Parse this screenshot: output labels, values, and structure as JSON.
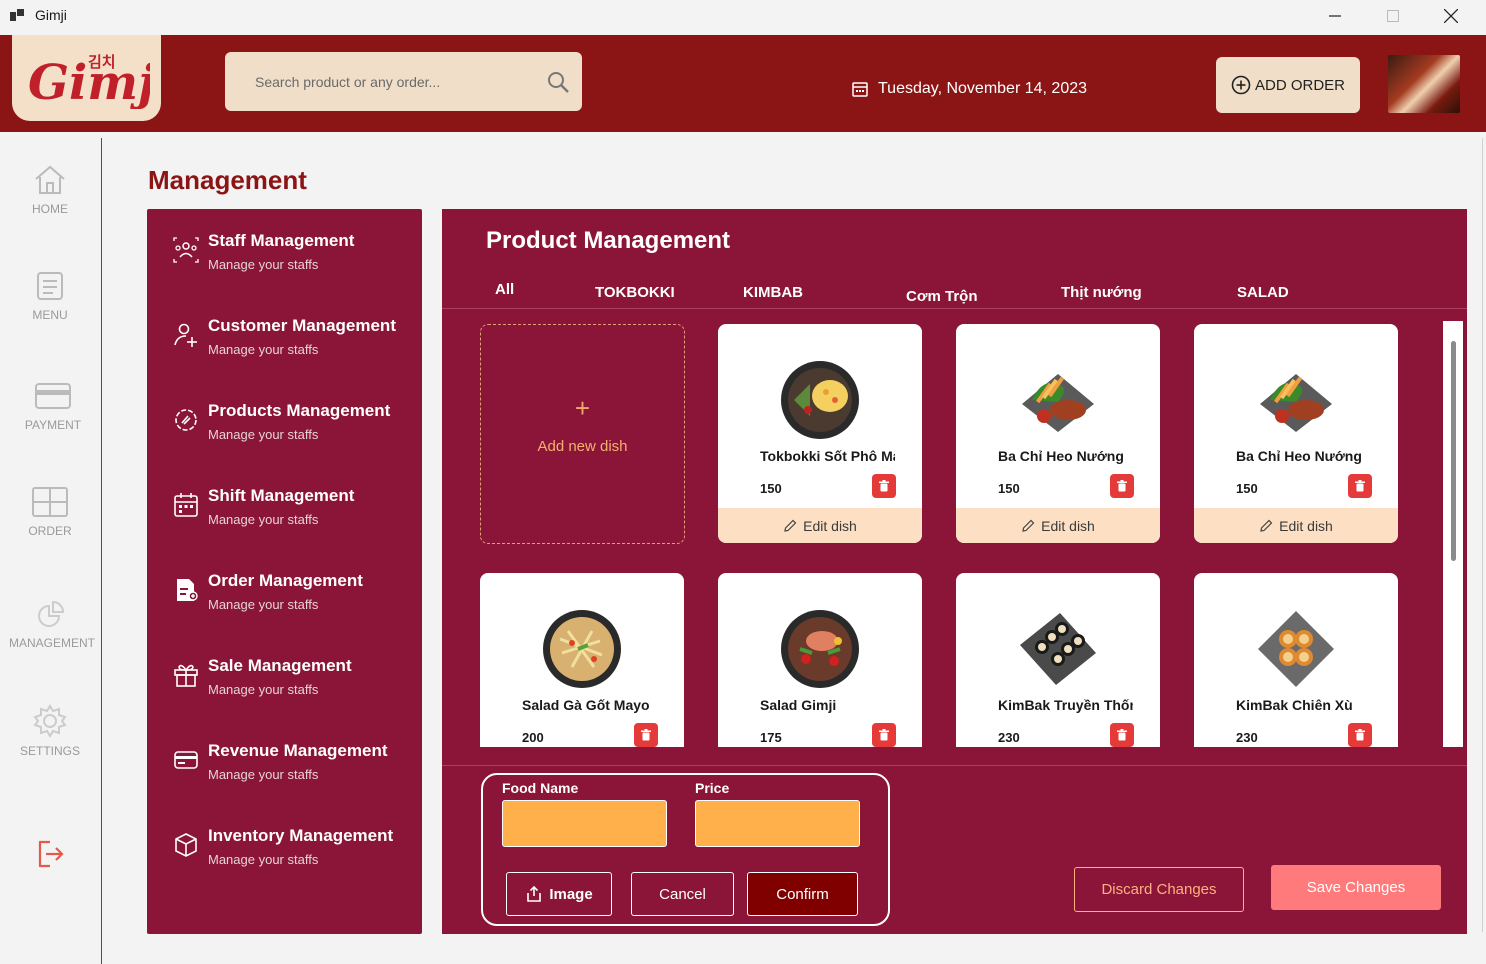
{
  "window": {
    "title": "Gimji"
  },
  "header": {
    "logo_text": "Gimji",
    "logo_korean": "김치",
    "search_placeholder": "Search product or any order...",
    "date": "Tuesday, November 14, 2023",
    "add_order_label": "ADD ORDER"
  },
  "nav": {
    "items": [
      {
        "label": "HOME",
        "icon": "home-icon"
      },
      {
        "label": "MENU",
        "icon": "menu-icon"
      },
      {
        "label": "PAYMENT",
        "icon": "payment-icon"
      },
      {
        "label": "ORDER",
        "icon": "order-icon"
      },
      {
        "label": "MANAGEMENT",
        "icon": "management-icon"
      },
      {
        "label": "SETTINGS",
        "icon": "gear-icon"
      }
    ],
    "logout_icon": "logout-icon"
  },
  "page": {
    "title": "Management"
  },
  "management": {
    "items": [
      {
        "title": "Staff Management",
        "subtitle": "Manage your staffs",
        "icon": "staff-icon"
      },
      {
        "title": "Customer Management",
        "subtitle": "Manage your staffs",
        "icon": "customer-icon"
      },
      {
        "title": "Products Management",
        "subtitle": "Manage your staffs",
        "icon": "products-icon"
      },
      {
        "title": "Shift Management",
        "subtitle": "Manage your staffs",
        "icon": "calendar-icon"
      },
      {
        "title": "Order Management",
        "subtitle": "Manage your staffs",
        "icon": "order-doc-icon"
      },
      {
        "title": "Sale Management",
        "subtitle": "Manage your staffs",
        "icon": "gift-icon"
      },
      {
        "title": "Revenue Management",
        "subtitle": "Manage your staffs",
        "icon": "card-icon"
      },
      {
        "title": "Inventory Management",
        "subtitle": "Manage your staffs",
        "icon": "box-icon"
      }
    ]
  },
  "products": {
    "title": "Product Management",
    "tabs": [
      "All",
      "TOKBOKKI",
      "KIMBAB",
      "Cơm Trộn",
      "Thịt nướng",
      "SALAD"
    ],
    "add_new_label": "Add new dish",
    "add_plus": "+",
    "edit_label": "Edit dish",
    "dishes": [
      {
        "name": "Tokbokki Sốt Phô Mai",
        "price": "150",
        "image": "tokbokki-image"
      },
      {
        "name": "Ba Chỉ Heo Nướng",
        "price": "150",
        "image": "grilled-pork-image"
      },
      {
        "name": "Ba Chỉ Heo Nướng",
        "price": "150",
        "image": "grilled-pork-image"
      },
      {
        "name": "Salad Gà Gốt Mayo",
        "price": "200",
        "image": "salad-image"
      },
      {
        "name": "Salad Gimji",
        "price": "175",
        "image": "salad-gimji-image"
      },
      {
        "name": "KimBak Truyền Thống",
        "price": "230",
        "image": "kimbap-image"
      },
      {
        "name": "KimBak Chiên Xù",
        "price": "230",
        "image": "fried-kimbap-image"
      }
    ]
  },
  "form": {
    "food_name_label": "Food Name",
    "price_label": "Price",
    "food_name_value": "",
    "price_value": "",
    "image_label": "Image",
    "cancel_label": "Cancel",
    "confirm_label": "Confirm"
  },
  "actions": {
    "discard_label": "Discard Changes",
    "save_label": "Save Changes"
  },
  "colors": {
    "brand": "#8b1515",
    "panel": "#8a1538",
    "accent": "#ffb04a",
    "save": "#ff7a7a",
    "delete": "#e53a3a"
  }
}
